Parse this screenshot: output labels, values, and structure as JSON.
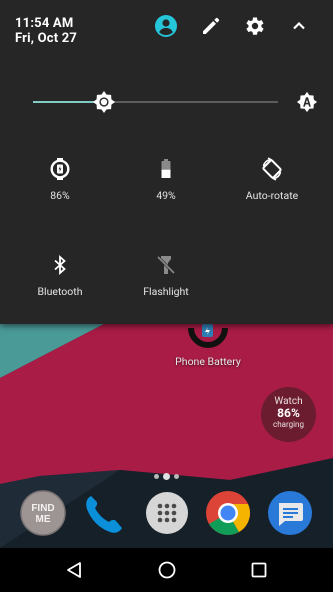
{
  "status": {
    "time": "11:54 AM",
    "date": "Fri, Oct 27"
  },
  "header_icons": {
    "account": "account-circle-icon",
    "edit": "pencil-icon",
    "settings": "gear-icon",
    "collapse": "chevron-up-icon"
  },
  "brightness": {
    "level": 0.29,
    "auto_icon": "brightness-auto-icon"
  },
  "tiles": [
    {
      "label": "86%",
      "icon": "watch-battery-icon"
    },
    {
      "label": "49%",
      "icon": "battery-icon"
    },
    {
      "label": "Auto-rotate",
      "icon": "screen-rotation-icon"
    },
    {
      "label": "Bluetooth",
      "icon": "bluetooth-icon"
    },
    {
      "label": "Flashlight",
      "icon": "flashlight-off-icon"
    }
  ],
  "home": {
    "widget_label": "Phone Battery",
    "watch_badge": {
      "title": "Watch",
      "percent": "86%",
      "status": "charging"
    },
    "dock": [
      {
        "label": "FIND ME",
        "line1": "FIND",
        "line2": "ME"
      },
      {
        "label": "Phone",
        "icon": "phone-icon"
      },
      {
        "label": "Apps",
        "icon": "app-drawer-icon"
      },
      {
        "label": "Chrome",
        "icon": "chrome-icon"
      },
      {
        "label": "Messages",
        "icon": "messages-icon"
      }
    ]
  },
  "navbar": {
    "back": "back-icon",
    "home": "home-icon",
    "recents": "recents-icon"
  },
  "colors": {
    "shade_bg": "#262626",
    "accent_teal": "#80cbc4",
    "account_cyan": "#26c6da",
    "wallpaper_crimson": "#a81c46",
    "wallpaper_teal": "#4a9a98",
    "wallpaper_navy": "#18242f"
  }
}
